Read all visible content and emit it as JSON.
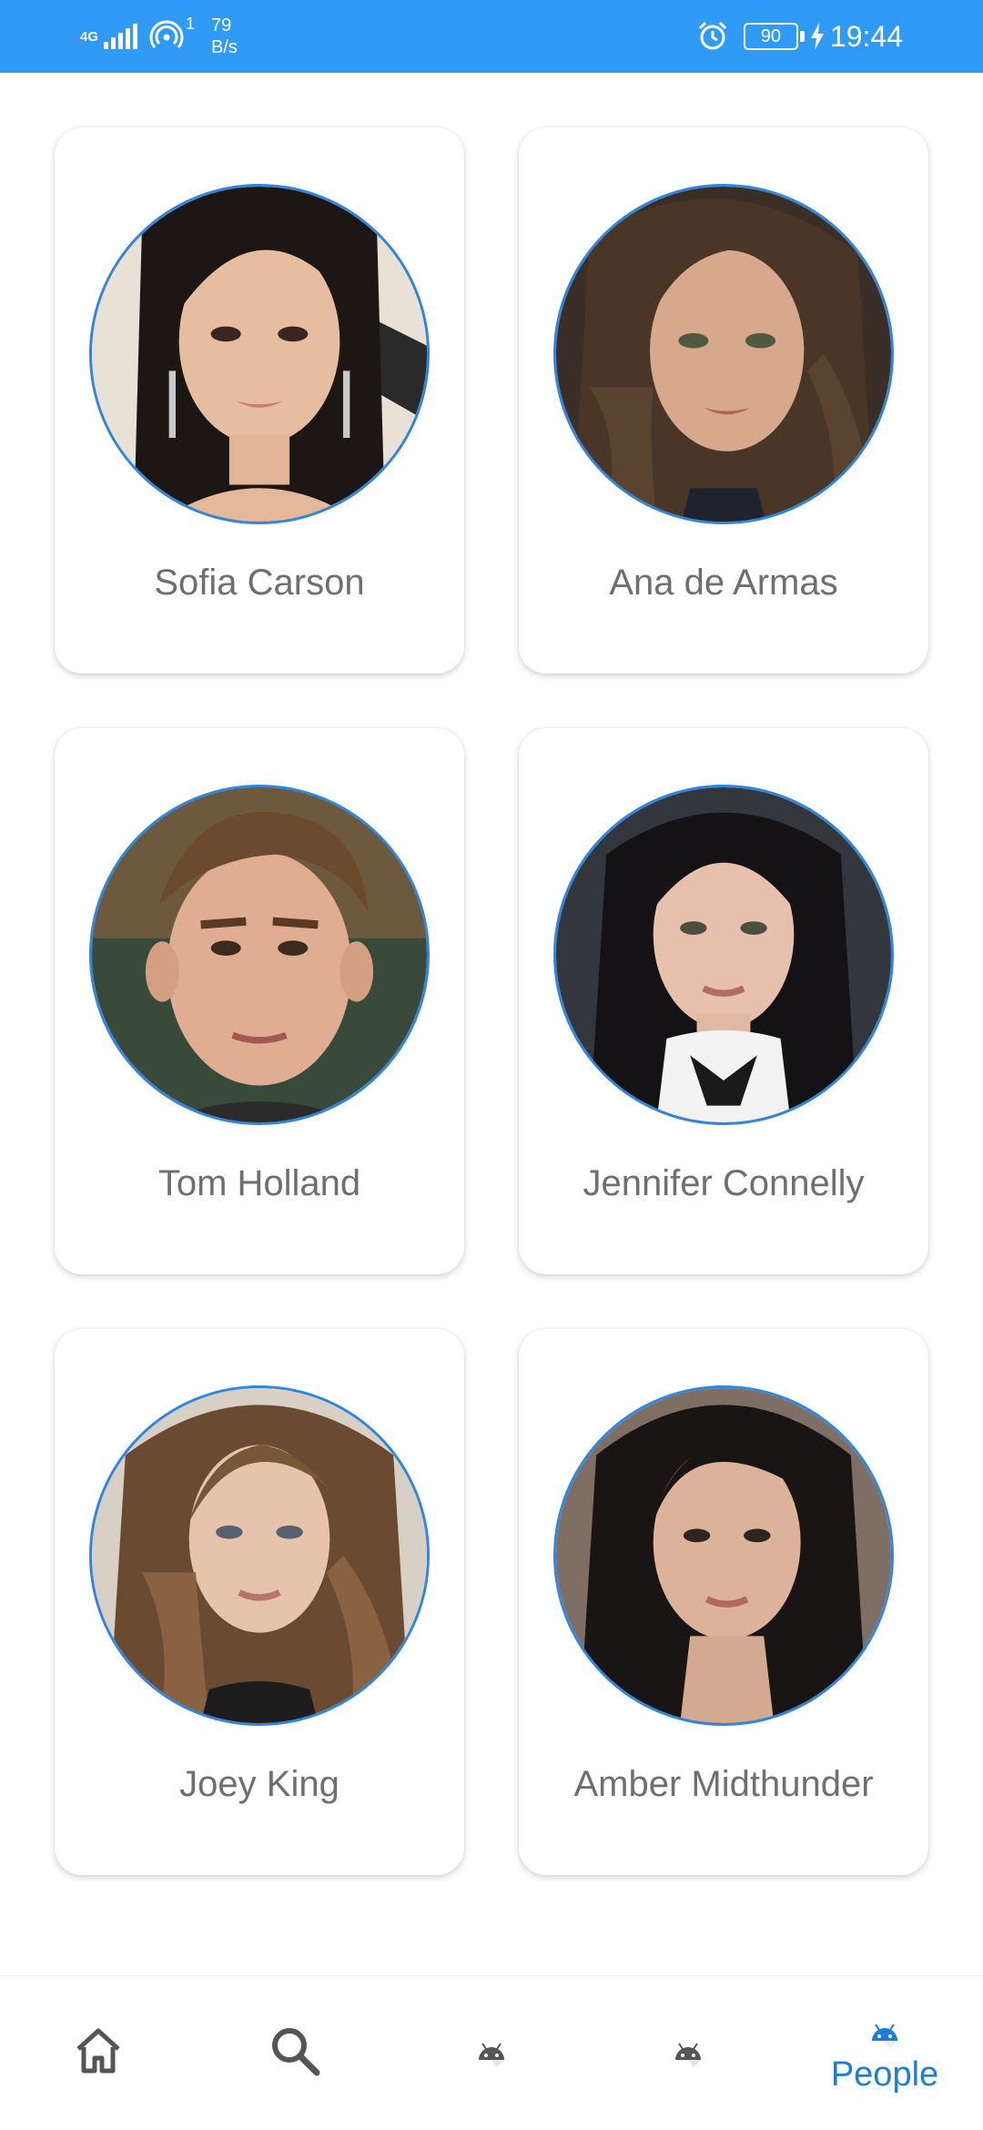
{
  "status_bar": {
    "network_type": "4G",
    "hotspot_count": "1",
    "net_speed_value": "79",
    "net_speed_unit": "B/s",
    "battery": "90",
    "time": "19:44",
    "icons": [
      "signal-icon",
      "hotspot-icon",
      "alarm-icon",
      "battery-icon",
      "charging-icon"
    ]
  },
  "people": [
    {
      "name": "Sofia Carson"
    },
    {
      "name": "Ana de Armas"
    },
    {
      "name": "Tom Holland"
    },
    {
      "name": "Jennifer Connelly"
    },
    {
      "name": "Joey King"
    },
    {
      "name": "Amber Midthunder"
    }
  ],
  "bottom_nav": {
    "items": [
      {
        "icon": "home-icon",
        "label": ""
      },
      {
        "icon": "search-icon",
        "label": ""
      },
      {
        "icon": "android-icon",
        "label": ""
      },
      {
        "icon": "android-icon",
        "label": ""
      },
      {
        "icon": "android-icon",
        "label": "People"
      }
    ],
    "active_index": 4
  },
  "colors": {
    "status_bar": "#2f9bf7",
    "avatar_border": "#2e86de",
    "active_nav": "#1c7ed6",
    "name_text": "#6f6f6f"
  }
}
